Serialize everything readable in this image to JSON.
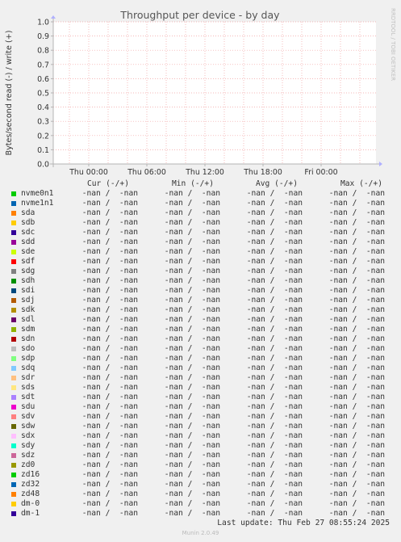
{
  "chart_data": {
    "type": "line",
    "title": "Throughput per device - by day",
    "ylabel": "Bytes/second read (-) / write (+)",
    "xlabel": "",
    "ylim": [
      0.0,
      1.0
    ],
    "y_ticks": [
      "0.0",
      "0.1",
      "0.2",
      "0.3",
      "0.4",
      "0.5",
      "0.6",
      "0.7",
      "0.8",
      "0.9",
      "1.0"
    ],
    "x_ticks": [
      "Thu 00:00",
      "Thu 06:00",
      "Thu 12:00",
      "Thu 18:00",
      "Fri 00:00"
    ],
    "grid": true,
    "watermark": "RRDTOOL / TOBI OETIKER",
    "series": []
  },
  "legend": {
    "headers": {
      "cur": "Cur (-/+)",
      "min": "Min (-/+)",
      "avg": "Avg (-/+)",
      "max": "Max (-/+)"
    },
    "devices": [
      {
        "name": "nvme0n1",
        "color": "#00cc00",
        "cur": "-nan /  -nan",
        "min": "-nan /  -nan",
        "avg": "-nan /  -nan",
        "max": "-nan /  -nan"
      },
      {
        "name": "nvme1n1",
        "color": "#0066b3",
        "cur": "-nan /  -nan",
        "min": "-nan /  -nan",
        "avg": "-nan /  -nan",
        "max": "-nan /  -nan"
      },
      {
        "name": "sda",
        "color": "#ff8000",
        "cur": "-nan /  -nan",
        "min": "-nan /  -nan",
        "avg": "-nan /  -nan",
        "max": "-nan /  -nan"
      },
      {
        "name": "sdb",
        "color": "#ffcc00",
        "cur": "-nan /  -nan",
        "min": "-nan /  -nan",
        "avg": "-nan /  -nan",
        "max": "-nan /  -nan"
      },
      {
        "name": "sdc",
        "color": "#330099",
        "cur": "-nan /  -nan",
        "min": "-nan /  -nan",
        "avg": "-nan /  -nan",
        "max": "-nan /  -nan"
      },
      {
        "name": "sdd",
        "color": "#990099",
        "cur": "-nan /  -nan",
        "min": "-nan /  -nan",
        "avg": "-nan /  -nan",
        "max": "-nan /  -nan"
      },
      {
        "name": "sde",
        "color": "#ccff00",
        "cur": "-nan /  -nan",
        "min": "-nan /  -nan",
        "avg": "-nan /  -nan",
        "max": "-nan /  -nan"
      },
      {
        "name": "sdf",
        "color": "#ff0000",
        "cur": "-nan /  -nan",
        "min": "-nan /  -nan",
        "avg": "-nan /  -nan",
        "max": "-nan /  -nan"
      },
      {
        "name": "sdg",
        "color": "#808080",
        "cur": "-nan /  -nan",
        "min": "-nan /  -nan",
        "avg": "-nan /  -nan",
        "max": "-nan /  -nan"
      },
      {
        "name": "sdh",
        "color": "#008f00",
        "cur": "-nan /  -nan",
        "min": "-nan /  -nan",
        "avg": "-nan /  -nan",
        "max": "-nan /  -nan"
      },
      {
        "name": "sdi",
        "color": "#00487d",
        "cur": "-nan /  -nan",
        "min": "-nan /  -nan",
        "avg": "-nan /  -nan",
        "max": "-nan /  -nan"
      },
      {
        "name": "sdj",
        "color": "#b35a00",
        "cur": "-nan /  -nan",
        "min": "-nan /  -nan",
        "avg": "-nan /  -nan",
        "max": "-nan /  -nan"
      },
      {
        "name": "sdk",
        "color": "#b38f00",
        "cur": "-nan /  -nan",
        "min": "-nan /  -nan",
        "avg": "-nan /  -nan",
        "max": "-nan /  -nan"
      },
      {
        "name": "sdl",
        "color": "#6b006b",
        "cur": "-nan /  -nan",
        "min": "-nan /  -nan",
        "avg": "-nan /  -nan",
        "max": "-nan /  -nan"
      },
      {
        "name": "sdm",
        "color": "#8fb300",
        "cur": "-nan /  -nan",
        "min": "-nan /  -nan",
        "avg": "-nan /  -nan",
        "max": "-nan /  -nan"
      },
      {
        "name": "sdn",
        "color": "#b30000",
        "cur": "-nan /  -nan",
        "min": "-nan /  -nan",
        "avg": "-nan /  -nan",
        "max": "-nan /  -nan"
      },
      {
        "name": "sdo",
        "color": "#bebebe",
        "cur": "-nan /  -nan",
        "min": "-nan /  -nan",
        "avg": "-nan /  -nan",
        "max": "-nan /  -nan"
      },
      {
        "name": "sdp",
        "color": "#80ff80",
        "cur": "-nan /  -nan",
        "min": "-nan /  -nan",
        "avg": "-nan /  -nan",
        "max": "-nan /  -nan"
      },
      {
        "name": "sdq",
        "color": "#80c9ff",
        "cur": "-nan /  -nan",
        "min": "-nan /  -nan",
        "avg": "-nan /  -nan",
        "max": "-nan /  -nan"
      },
      {
        "name": "sdr",
        "color": "#ffc080",
        "cur": "-nan /  -nan",
        "min": "-nan /  -nan",
        "avg": "-nan /  -nan",
        "max": "-nan /  -nan"
      },
      {
        "name": "sds",
        "color": "#ffe680",
        "cur": "-nan /  -nan",
        "min": "-nan /  -nan",
        "avg": "-nan /  -nan",
        "max": "-nan /  -nan"
      },
      {
        "name": "sdt",
        "color": "#aa80ff",
        "cur": "-nan /  -nan",
        "min": "-nan /  -nan",
        "avg": "-nan /  -nan",
        "max": "-nan /  -nan"
      },
      {
        "name": "sdu",
        "color": "#ee00cc",
        "cur": "-nan /  -nan",
        "min": "-nan /  -nan",
        "avg": "-nan /  -nan",
        "max": "-nan /  -nan"
      },
      {
        "name": "sdv",
        "color": "#ff8080",
        "cur": "-nan /  -nan",
        "min": "-nan /  -nan",
        "avg": "-nan /  -nan",
        "max": "-nan /  -nan"
      },
      {
        "name": "sdw",
        "color": "#666600",
        "cur": "-nan /  -nan",
        "min": "-nan /  -nan",
        "avg": "-nan /  -nan",
        "max": "-nan /  -nan"
      },
      {
        "name": "sdx",
        "color": "#ffbfff",
        "cur": "-nan /  -nan",
        "min": "-nan /  -nan",
        "avg": "-nan /  -nan",
        "max": "-nan /  -nan"
      },
      {
        "name": "sdy",
        "color": "#00ffcc",
        "cur": "-nan /  -nan",
        "min": "-nan /  -nan",
        "avg": "-nan /  -nan",
        "max": "-nan /  -nan"
      },
      {
        "name": "sdz",
        "color": "#cc6699",
        "cur": "-nan /  -nan",
        "min": "-nan /  -nan",
        "avg": "-nan /  -nan",
        "max": "-nan /  -nan"
      },
      {
        "name": "zd0",
        "color": "#999900",
        "cur": "-nan /  -nan",
        "min": "-nan /  -nan",
        "avg": "-nan /  -nan",
        "max": "-nan /  -nan"
      },
      {
        "name": "zd16",
        "color": "#00cc00",
        "cur": "-nan /  -nan",
        "min": "-nan /  -nan",
        "avg": "-nan /  -nan",
        "max": "-nan /  -nan"
      },
      {
        "name": "zd32",
        "color": "#0066b3",
        "cur": "-nan /  -nan",
        "min": "-nan /  -nan",
        "avg": "-nan /  -nan",
        "max": "-nan /  -nan"
      },
      {
        "name": "zd48",
        "color": "#ff8000",
        "cur": "-nan /  -nan",
        "min": "-nan /  -nan",
        "avg": "-nan /  -nan",
        "max": "-nan /  -nan"
      },
      {
        "name": "dm-0",
        "color": "#ffcc00",
        "cur": "-nan /  -nan",
        "min": "-nan /  -nan",
        "avg": "-nan /  -nan",
        "max": "-nan /  -nan"
      },
      {
        "name": "dm-1",
        "color": "#330099",
        "cur": "-nan /  -nan",
        "min": "-nan /  -nan",
        "avg": "-nan /  -nan",
        "max": "-nan /  -nan"
      }
    ]
  },
  "footer": {
    "last_update": "Last update: Thu Feb 27 08:55:24 2025",
    "version": "Munin 2.0.49"
  }
}
